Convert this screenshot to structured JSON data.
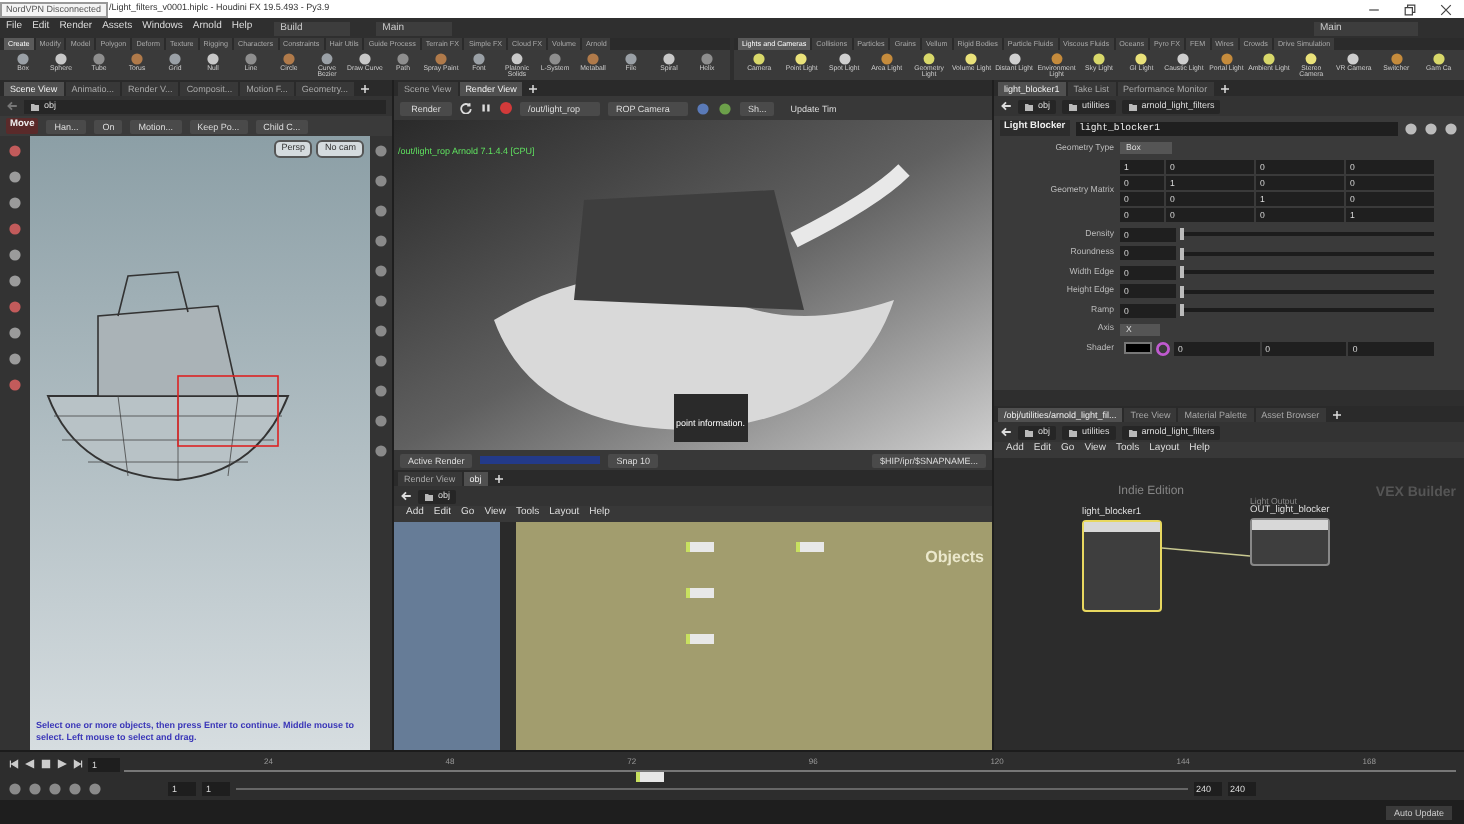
{
  "title_bar": {
    "vpn_badge": "NordVPN Disconnected",
    "title": "/Light_filters_v0001.hiplc - Houdini FX 19.5.493 - Py3.9"
  },
  "menu_bar": {
    "menus": [
      "File",
      "Edit",
      "Render",
      "Assets",
      "Windows",
      "Arnold",
      "Help"
    ],
    "desktop": "Build",
    "main": "Main",
    "right_desktop": "Main"
  },
  "shelf_left": {
    "tabs": [
      {
        "label": "Create",
        "selected": true
      },
      {
        "label": "Modify",
        "selected": false
      },
      {
        "label": "Model",
        "selected": false
      },
      {
        "label": "Polygon",
        "selected": false
      },
      {
        "label": "Deform",
        "selected": false
      },
      {
        "label": "Texture",
        "selected": false
      },
      {
        "label": "Rigging",
        "selected": false
      },
      {
        "label": "Characters",
        "selected": false
      },
      {
        "label": "Constraints",
        "selected": false
      },
      {
        "label": "Hair Utils",
        "selected": false
      },
      {
        "label": "Guide Process",
        "selected": false
      },
      {
        "label": "Terrain FX",
        "selected": false
      },
      {
        "label": "Simple FX",
        "selected": false
      },
      {
        "label": "Cloud FX",
        "selected": false
      },
      {
        "label": "Volume",
        "selected": false
      },
      {
        "label": "Arnold",
        "selected": false
      }
    ],
    "tools": [
      "Box",
      "Sphere",
      "Tube",
      "Torus",
      "Grid",
      "Null",
      "Line",
      "Circle",
      "Curve Bezier",
      "Draw Curve",
      "Path",
      "Spray Paint",
      "Font",
      "Platonic Solids",
      "L-System",
      "Metaball",
      "File",
      "Spiral",
      "Helix"
    ]
  },
  "shelf_right": {
    "tabs": [
      {
        "label": "Lights and Cameras",
        "selected": true
      },
      {
        "label": "Collisions",
        "selected": false
      },
      {
        "label": "Particles",
        "selected": false
      },
      {
        "label": "Grains",
        "selected": false
      },
      {
        "label": "Vellum",
        "selected": false
      },
      {
        "label": "Rigid Bodies",
        "selected": false
      },
      {
        "label": "Particle Fluids",
        "selected": false
      },
      {
        "label": "Viscous Fluids",
        "selected": false
      },
      {
        "label": "Oceans",
        "selected": false
      },
      {
        "label": "Pyro FX",
        "selected": false
      },
      {
        "label": "FEM",
        "selected": false
      },
      {
        "label": "Wires",
        "selected": false
      },
      {
        "label": "Crowds",
        "selected": false
      },
      {
        "label": "Drive Simulation",
        "selected": false
      }
    ],
    "tools": [
      "Camera",
      "Point Light",
      "Spot Light",
      "Area Light",
      "Geometry Light",
      "Volume Light",
      "Distant Light",
      "Environment Light",
      "Sky Light",
      "GI Light",
      "Caustic Light",
      "Portal Light",
      "Ambient Light",
      "Stereo Camera",
      "VR Camera",
      "Switcher",
      "Gam Ca"
    ]
  },
  "scene_viewer": {
    "tabs": [
      {
        "label": "Scene View",
        "selected": true
      },
      {
        "label": "Animatio...",
        "selected": false
      },
      {
        "label": "Render V...",
        "selected": false
      },
      {
        "label": "Composit...",
        "selected": false
      },
      {
        "label": "Motion F...",
        "selected": false
      },
      {
        "label": "Geometry...",
        "selected": false
      }
    ],
    "path": "obj",
    "tool": "Move",
    "options": [
      "Han...",
      "On",
      "Motion...",
      "Keep Po...",
      "Child C..."
    ],
    "camera_buttons": [
      "Persp",
      "No cam"
    ],
    "prompt": "Select one or more objects, then press Enter to continue. Middle mouse to select. Left mouse to select and drag."
  },
  "render_view": {
    "tabs": [
      {
        "label": "Scene View",
        "selected": false
      },
      {
        "label": "Render View",
        "selected": true
      }
    ],
    "render_button": "Render",
    "rop": "/out/light_rop",
    "camera": "ROP Camera",
    "shading": "Sh...",
    "update": "Update Tim",
    "overlay": "/out/light_rop  Arnold 7.1.4.4 [CPU]",
    "caption": "point information.",
    "mode": "Active Render",
    "snap": "Snap 10",
    "snap_path": "$HIP/ipr/$SNAPNAME..."
  },
  "obj_network": {
    "tabs": [
      {
        "label": "Render View",
        "selected": false
      },
      {
        "label": "obj",
        "selected": true
      }
    ],
    "path": "obj",
    "menus": [
      "Add",
      "Edit",
      "Go",
      "View",
      "Tools",
      "Layout",
      "Help"
    ],
    "context_label": "Objects"
  },
  "parameters": {
    "tabs": [
      {
        "label": "light_blocker1",
        "selected": true
      },
      {
        "label": "Take List",
        "selected": false
      },
      {
        "label": "Performance Monitor",
        "selected": false
      }
    ],
    "path": [
      "obj",
      "utilities",
      "arnold_light_filters"
    ],
    "node_type": "Light Blocker",
    "node_name": "light_blocker1",
    "geometry_type": {
      "label": "Geometry Type",
      "value": "Box"
    },
    "matrix": {
      "label": "Geometry Matrix",
      "rows": [
        [
          "1",
          "0",
          "0",
          "0"
        ],
        [
          "0",
          "1",
          "0",
          "0"
        ],
        [
          "0",
          "0",
          "1",
          "0"
        ],
        [
          "0",
          "0",
          "0",
          "1"
        ]
      ]
    },
    "sliders": [
      {
        "label": "Density",
        "value": "0",
        "level": 0
      },
      {
        "label": "Roundness",
        "value": "0",
        "level": 0
      },
      {
        "label": "Width Edge",
        "value": "0",
        "level": 0
      },
      {
        "label": "Height Edge",
        "value": "0",
        "level": 0
      },
      {
        "label": "Ramp",
        "value": "0",
        "level": 0
      }
    ],
    "axis": {
      "label": "Axis",
      "value": "X"
    },
    "shader": {
      "label": "Shader",
      "color": "#000000",
      "values": [
        "0",
        "0",
        "0"
      ]
    }
  },
  "vex_network": {
    "tabs": [
      {
        "label": "/obj/utilities/arnold_light_fil...",
        "selected": true
      },
      {
        "label": "Tree View",
        "selected": false
      },
      {
        "label": "Material Palette",
        "selected": false
      },
      {
        "label": "Asset Browser",
        "selected": false
      }
    ],
    "path": [
      "obj",
      "utilities",
      "arnold_light_filters"
    ],
    "menus": [
      "Add",
      "Edit",
      "Go",
      "View",
      "Tools",
      "Layout",
      "Help"
    ],
    "edition": "Indie Edition",
    "context_label": "VEX Builder",
    "nodes": [
      {
        "title": "light_blocker1",
        "selected": true
      },
      {
        "subtitle": "Light Output",
        "title": "OUT_light_blocker",
        "selected": false
      }
    ]
  },
  "timeline": {
    "frame": "1",
    "ticks": [
      "24",
      "48",
      "72",
      "96",
      "120",
      "144",
      "168"
    ],
    "start": "1",
    "range_start": "1",
    "range_end": "240",
    "end": "240",
    "auto_update": "Auto Update"
  }
}
